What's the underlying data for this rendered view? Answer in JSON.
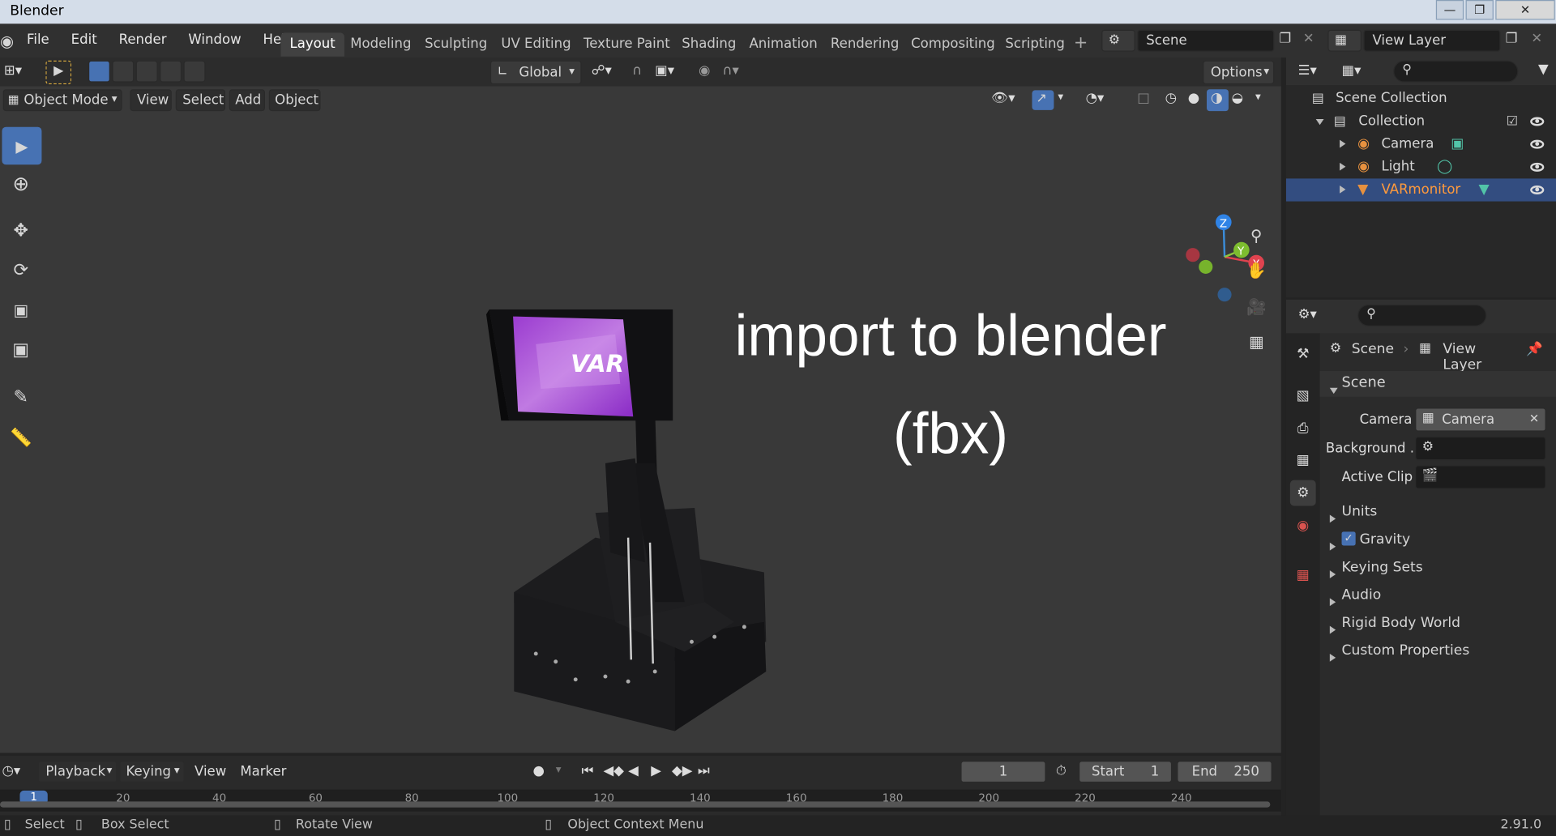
{
  "window": {
    "title": "Blender",
    "version": "2.91.0"
  },
  "menu": [
    "File",
    "Edit",
    "Render",
    "Window",
    "Help"
  ],
  "workspaces": [
    "Layout",
    "Modeling",
    "Sculpting",
    "UV Editing",
    "Texture Paint",
    "Shading",
    "Animation",
    "Rendering",
    "Compositing",
    "Scripting"
  ],
  "scene_field": "Scene",
  "view_layer_field": "View Layer",
  "tool_header": {
    "orientation": "Global",
    "options": "Options"
  },
  "viewport_header": {
    "mode": "Object Mode",
    "menus": [
      "View",
      "Select",
      "Add",
      "Object"
    ]
  },
  "overlay_text": {
    "line1": "import to blender",
    "line2": "(fbx)"
  },
  "model": {
    "screen_logo": "VAR"
  },
  "gizmo": {
    "x": "X",
    "y": "Y",
    "z": "Z"
  },
  "outliner": {
    "root": "Scene Collection",
    "collection": "Collection",
    "items": [
      "Camera",
      "Light",
      "VARmonitor"
    ]
  },
  "properties": {
    "breadcrumb": [
      "Scene",
      "View Layer"
    ],
    "panel": "Scene",
    "camera_label": "Camera",
    "camera_value": "Camera",
    "background_label": "Background ...",
    "clip_label": "Active Clip",
    "sections": [
      "Units",
      "Gravity",
      "Keying Sets",
      "Audio",
      "Rigid Body World",
      "Custom Properties"
    ]
  },
  "timeline": {
    "menus": [
      "Playback",
      "Keying",
      "View",
      "Marker"
    ],
    "current_frame": "1",
    "start_label": "Start",
    "start": "1",
    "end_label": "End",
    "end": "250",
    "ruler": [
      "1",
      "20",
      "40",
      "60",
      "80",
      "100",
      "120",
      "140",
      "160",
      "180",
      "200",
      "220",
      "240"
    ]
  },
  "status": {
    "select": "Select",
    "box_select": "Box Select",
    "rotate": "Rotate View",
    "context": "Object Context Menu"
  },
  "colors": {
    "accent": "#4772b3",
    "selected_text": "#ff9a3c",
    "bg": "#393939"
  }
}
